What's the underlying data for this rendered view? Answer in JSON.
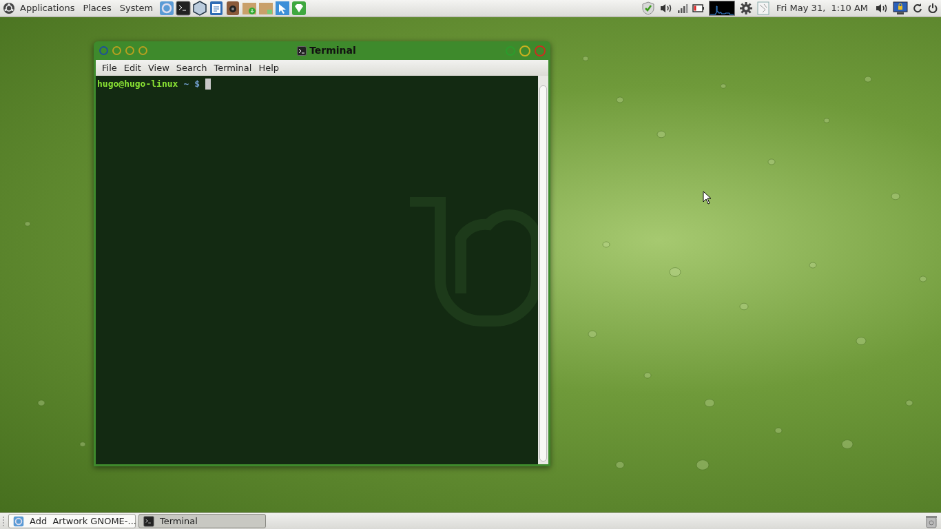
{
  "top_panel": {
    "menus": [
      "Applications",
      "Places",
      "System"
    ],
    "launchers": [
      {
        "kind": "browser"
      },
      {
        "kind": "terminal"
      },
      {
        "kind": "cube"
      },
      {
        "kind": "document"
      },
      {
        "kind": "speaker"
      },
      {
        "kind": "package-down"
      },
      {
        "kind": "package"
      },
      {
        "kind": "pointer"
      },
      {
        "kind": "gem"
      }
    ],
    "clock": "Fri May 31,  1:10 AM"
  },
  "terminal_window": {
    "title": "Terminal",
    "menu": [
      "File",
      "Edit",
      "View",
      "Search",
      "Terminal",
      "Help"
    ],
    "prompt": {
      "user_host": "hugo@hugo-linux",
      "path": "~",
      "symbol": "$"
    }
  },
  "taskbar": {
    "tasks": [
      {
        "kind": "browser",
        "label": "Add  Artwork GNOME-...",
        "selected": false
      },
      {
        "kind": "terminal",
        "label": "Terminal",
        "selected": true
      }
    ]
  }
}
